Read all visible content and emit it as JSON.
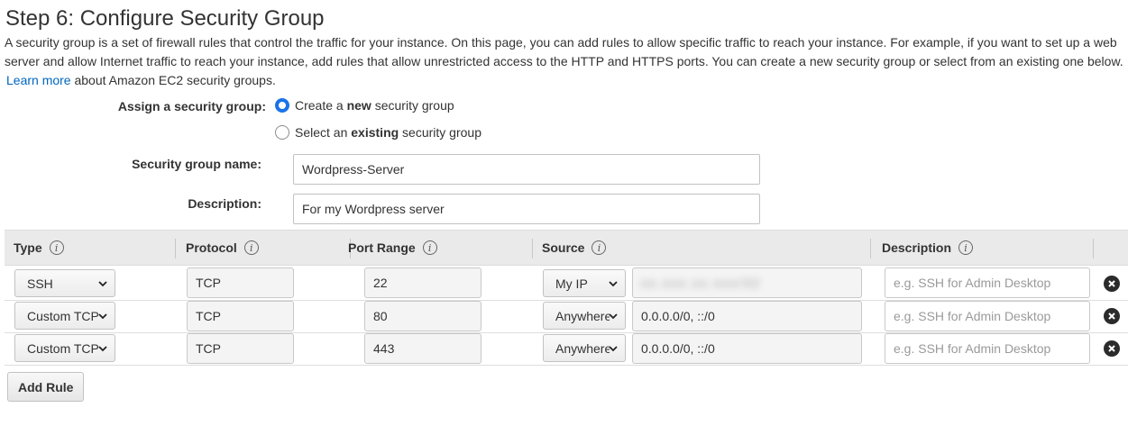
{
  "page": {
    "title": "Step 6: Configure Security Group",
    "intro": "A security group is a set of firewall rules that control the traffic for your instance. On this page, you can add rules to allow specific traffic to reach your instance. For example, if you want to set up a web server and allow Internet traffic to reach your instance, add rules that allow unrestricted access to the HTTP and HTTPS ports. You can create a new security group or select from an existing one below.",
    "learn_more_link": "Learn more",
    "learn_more_suffix": "about Amazon EC2 security groups."
  },
  "assign": {
    "label": "Assign a security group:",
    "options": [
      {
        "prefix": "Create a ",
        "bold": "new",
        "suffix": " security group",
        "checked": true
      },
      {
        "prefix": "Select an ",
        "bold": "existing",
        "suffix": " security group",
        "checked": false
      }
    ]
  },
  "form": {
    "name_label": "Security group name:",
    "name_value": "Wordpress-Server",
    "description_label": "Description:",
    "description_value": "For my Wordpress server"
  },
  "table": {
    "headers": {
      "type": "Type",
      "protocol": "Protocol",
      "port_range": "Port Range",
      "source": "Source",
      "description": "Description"
    },
    "description_placeholder": "e.g. SSH for Admin Desktop",
    "rows": [
      {
        "type": "SSH",
        "protocol": "TCP",
        "port": "22",
        "source_type": "My IP",
        "source_value": "xx.xxx.xx.xxx/32",
        "source_blurred": true
      },
      {
        "type": "Custom TCP",
        "protocol": "TCP",
        "port": "80",
        "source_type": "Anywhere",
        "source_value": "0.0.0.0/0, ::/0",
        "source_blurred": false
      },
      {
        "type": "Custom TCP",
        "protocol": "TCP",
        "port": "443",
        "source_type": "Anywhere",
        "source_value": "0.0.0.0/0, ::/0",
        "source_blurred": false
      }
    ]
  },
  "actions": {
    "add_rule": "Add Rule"
  },
  "icons": {
    "info": "info-icon",
    "chevron": "chevron-down-icon",
    "remove": "close-circle-icon"
  },
  "colors": {
    "link": "#0066c0",
    "radio_selected": "#1a73e8",
    "header_bg": "#eaeaea"
  }
}
